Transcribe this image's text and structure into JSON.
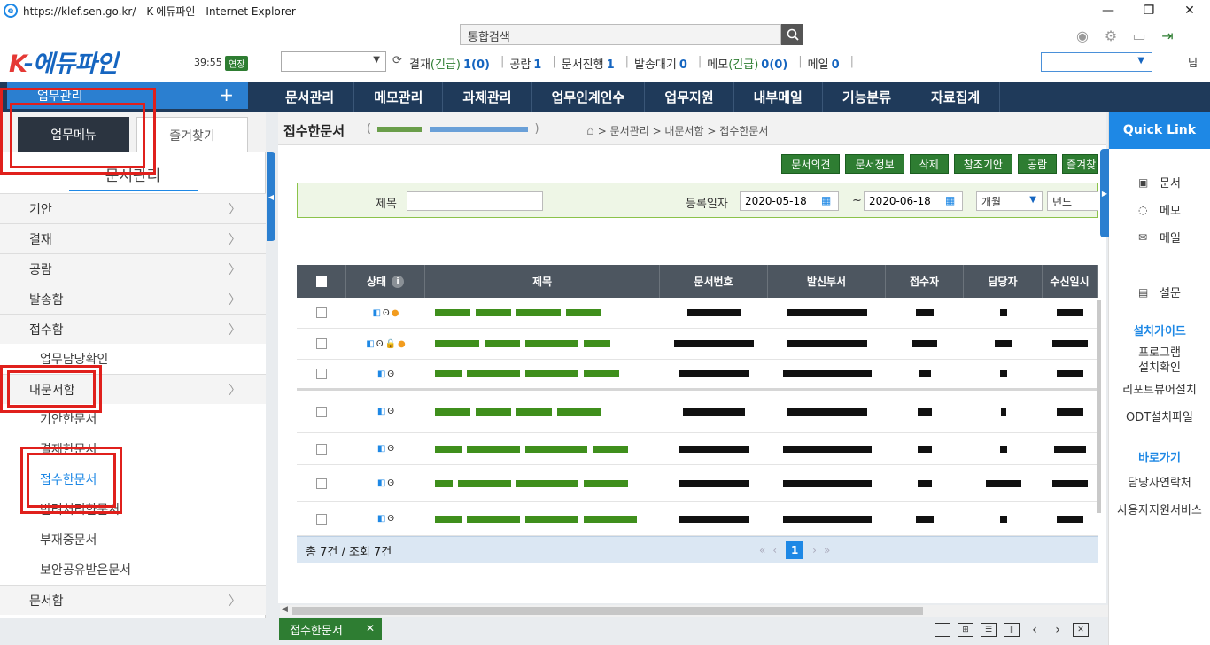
{
  "window": {
    "title": "https://klef.sen.go.kr/ - K-에듀파인 - Internet Explorer",
    "minimize": "—",
    "restore": "❐",
    "close": "✕"
  },
  "header": {
    "logo_k": "K",
    "logo_rest": "-에듀파인",
    "timer": "39:55",
    "extend_label": "연장",
    "search_placeholder": "통합검색",
    "counters": [
      {
        "label": "결재",
        "urgent": "(긴급)",
        "value": "1(0)"
      },
      {
        "label": "공람",
        "urgent": "",
        "value": "1"
      },
      {
        "label": "문서진행",
        "urgent": "",
        "value": "1"
      },
      {
        "label": "발송대기",
        "urgent": "",
        "value": "0"
      },
      {
        "label": "메모",
        "urgent": "(긴급)",
        "value": "0(0)"
      },
      {
        "label": "메일",
        "urgent": "",
        "value": "0"
      }
    ],
    "user_tail": "님"
  },
  "nav": {
    "quick_label": "업무관리",
    "menus": [
      "문서관리",
      "메모관리",
      "과제관리",
      "업무인계인수",
      "업무지원",
      "내부메일",
      "기능분류",
      "자료집계"
    ]
  },
  "left": {
    "tab_active": "업무메뉴",
    "tab_fav": "즐겨찾기",
    "section_title": "문서관리",
    "menu": {
      "m1": "기안",
      "m2": "결재",
      "m3": "공람",
      "m4": "발송함",
      "m5": "접수함",
      "s1": "업무담당확인",
      "m6": "내문서함",
      "s2": "기안한문서",
      "s3": "결재한문서",
      "s4": "접수한문서",
      "s5": "반려처리한문서",
      "s6": "부재중문서",
      "s7": "보안공유받은문서",
      "m7": "문서함"
    }
  },
  "content": {
    "page_title": "접수한문서",
    "page_sub_open": "(",
    "page_sub_close": ")",
    "breadcrumb": "> 문서관리 > 내문서함 > 접수한문서",
    "buttons": [
      "문서의견",
      "문서정보",
      "삭제",
      "참조기안",
      "공람",
      "즐겨찾기"
    ],
    "filter": {
      "title_label": "제목",
      "title_value": "",
      "date_label": "등록일자",
      "date_from": "2020-05-18",
      "tilde": "~",
      "date_to": "2020-06-18",
      "period": "개월",
      "year": "년도"
    },
    "columns": [
      "상태",
      "제목",
      "문서번호",
      "발신부서",
      "접수자",
      "담당자",
      "수신일시"
    ],
    "total": "총 7건 / 조회 7건",
    "page": "1"
  },
  "bottom": {
    "open_tab": "접수한문서"
  },
  "quicklink": {
    "title": "Quick Link",
    "items": [
      "문서",
      "메모",
      "메일",
      "설문"
    ],
    "install_title": "설치가이드",
    "install_links": [
      "프로그램 설치확인",
      "리포트뷰어설치",
      "ODT설치파일"
    ],
    "goto_title": "바로가기",
    "goto_links": [
      "담당자연락처",
      "사용자지원서비스"
    ]
  },
  "colors": {
    "nav_bg": "#1f3a5a",
    "accent_blue": "#1e88e5",
    "button_green": "#2e7d32",
    "annotation_red": "#e0201c"
  }
}
